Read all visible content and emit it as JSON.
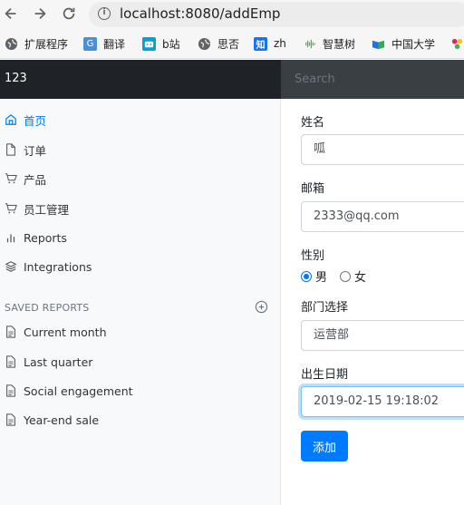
{
  "browser": {
    "url": "localhost:8080/addEmp",
    "bookmarks": [
      {
        "label": "扩展程序",
        "icon": "puzzle-icon"
      },
      {
        "label": "翻译",
        "icon": "translate-icon"
      },
      {
        "label": "b站",
        "icon": "bilibili-icon"
      },
      {
        "label": "思否",
        "icon": "globe-icon"
      },
      {
        "label": "zh",
        "icon": "zhihu-icon"
      },
      {
        "label": "智慧树",
        "icon": "audio-bars-icon"
      },
      {
        "label": "中国大学",
        "icon": "mooc-icon"
      }
    ]
  },
  "navbar": {
    "brand": "123",
    "search_placeholder": "Search"
  },
  "sidebar": {
    "items": [
      {
        "label": "首页",
        "icon": "home-icon",
        "active": true
      },
      {
        "label": "订单",
        "icon": "file-icon"
      },
      {
        "label": "产品",
        "icon": "cart-icon"
      },
      {
        "label": "员工管理",
        "icon": "cart-icon"
      },
      {
        "label": "Reports",
        "icon": "bar-chart-icon"
      },
      {
        "label": "Integrations",
        "icon": "layers-icon"
      }
    ],
    "saved_reports_heading": "SAVED REPORTS",
    "reports": [
      {
        "label": "Current month",
        "icon": "file-text-icon"
      },
      {
        "label": "Last quarter",
        "icon": "file-text-icon"
      },
      {
        "label": "Social engagement",
        "icon": "file-text-icon"
      },
      {
        "label": "Year-end sale",
        "icon": "file-text-icon"
      }
    ]
  },
  "form": {
    "name_label": "姓名",
    "name_value": "呱",
    "email_label": "邮箱",
    "email_value": "2333@qq.com",
    "gender_label": "性别",
    "gender_male": "男",
    "gender_female": "女",
    "gender_selected": "男",
    "department_label": "部门选择",
    "department_value": "运营部",
    "birth_label": "出生日期",
    "birth_value": "2019-02-15 19:18:02",
    "submit_label": "添加"
  },
  "colors": {
    "accent": "#007bff",
    "navbar": "#1f2226",
    "sidebar_bg": "#f8f9fa"
  }
}
